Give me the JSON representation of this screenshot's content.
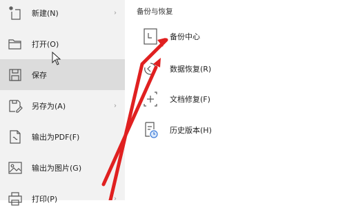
{
  "left_menu": {
    "items": [
      {
        "label": "新建(N)",
        "icon": "new-file-icon",
        "chevron": "›"
      },
      {
        "label": "打开(O)",
        "icon": "folder-icon",
        "chevron": ""
      },
      {
        "label": "保存",
        "icon": "save-icon",
        "chevron": ""
      },
      {
        "label": "另存为(A)",
        "icon": "save-as-icon",
        "chevron": "›"
      },
      {
        "label": "输出为PDF(F)",
        "icon": "export-pdf-icon",
        "chevron": ""
      },
      {
        "label": "输出为图片(G)",
        "icon": "export-image-icon",
        "chevron": ""
      },
      {
        "label": "打印(P)",
        "icon": "print-icon",
        "chevron": "›"
      }
    ]
  },
  "backup_panel": {
    "title": "备份与恢复",
    "items": [
      {
        "label": "备份中心",
        "icon": "backup-center-icon"
      },
      {
        "label": "数据恢复(R)",
        "icon": "data-recovery-icon"
      },
      {
        "label": "文档修复(F)",
        "icon": "document-repair-icon"
      },
      {
        "label": "历史版本(H)",
        "icon": "history-version-icon"
      }
    ]
  },
  "annotation": {
    "arrow_color": "#e02020"
  }
}
